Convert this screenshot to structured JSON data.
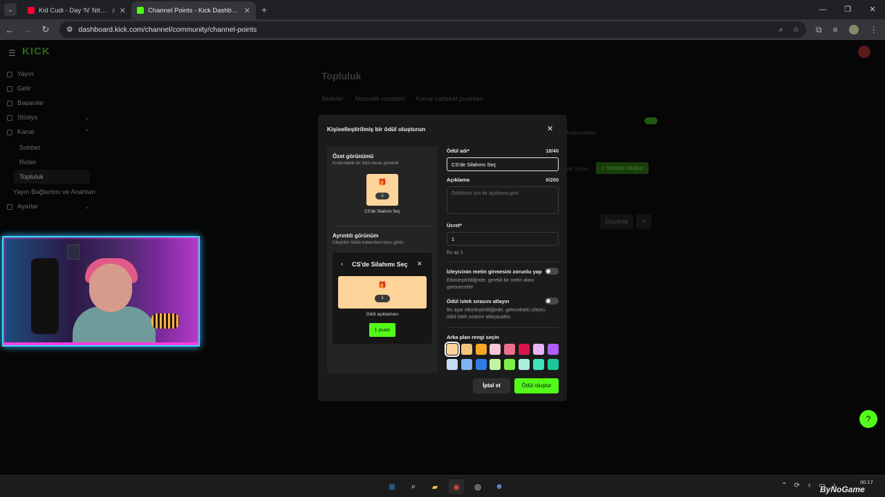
{
  "browser": {
    "tabs": [
      {
        "title": "Kid Cudi - Day 'N' Nite (Lyri",
        "favicon_color": "#ff0033"
      },
      {
        "title": "Channel Points - Kick Dashboar",
        "favicon_color": "#53fc18"
      }
    ],
    "url": "dashboard.kick.com/channel/community/channel-points"
  },
  "sidebar": {
    "logo": "KICK",
    "items": [
      {
        "label": "Yayın"
      },
      {
        "label": "Gelir"
      },
      {
        "label": "Başarılar"
      },
      {
        "label": "Stüdyo"
      },
      {
        "label": "Kanal"
      },
      {
        "label": "Sohbet"
      },
      {
        "label": "Roller"
      },
      {
        "label": "Topluluk"
      },
      {
        "label": "Yayın Bağlantısı ve Anahtarı"
      },
      {
        "label": "Ayarlar"
      }
    ]
  },
  "background_page": {
    "title": "Topluluk",
    "tabs": [
      "İfadeler",
      "Abonelik rozetleri",
      "Kanal sadakat puanları"
    ],
    "text_right": "kullanılabilir.",
    "text_queue": "ak sırası",
    "new_button": "+ Yenisini oluştur",
    "edit_button": "Düzenle"
  },
  "modal": {
    "title": "Kişiselleştirilmiş bir ödül oluşturun",
    "preview": {
      "summary_heading": "Özet görünümü",
      "summary_sub": "Kullanılabilir bir ödül olarak gösterilir",
      "card_count": "1",
      "card_label": "CS'de Silahımı Seç",
      "detail_heading": "Ayrıntılı görünüm",
      "detail_sub": "İzleyiciler ödülü kullanırken bunu görür",
      "detail_title": "CS'de Silahımı Seç",
      "detail_count": "1",
      "detail_desc": "Ödül açıklaması",
      "points_button": "1 puan"
    },
    "form": {
      "name_label": "Ödül adı*",
      "name_count": "18/40",
      "name_value": "CS'de Silahımı Seç",
      "desc_label": "Açıklama",
      "desc_count": "0/200",
      "desc_placeholder": "Ödülünüz için bir açıklama girin",
      "cost_label": "Ücret*",
      "cost_value": "1",
      "cost_note": "En az 1",
      "require_text_label": "İzleyicinin metin girmesini zorunlu yap",
      "require_text_note": "Etkinleştirildiğinde, gerekli bir metin alanı görünecektir",
      "skip_queue_label": "Ödül istek sırasını atlayın",
      "skip_queue_note": "Bu ayar etkinleştirildiğinde, gelecekteki izleyici ödül istek sırasını atlayacaktır.",
      "bg_color_label": "Arka plan rengi seçin",
      "swatches": [
        "#fdd49a",
        "#f5c27a",
        "#f5a623",
        "#f9c5d5",
        "#ec6f8f",
        "#d8164b",
        "#e7b5f5",
        "#b05cf6",
        "#c5dbf7",
        "#7fb2f0",
        "#2f7be5",
        "#c1f5a3",
        "#7bf04a",
        "#a8f0de",
        "#3fe3bd",
        "#19c99a"
      ],
      "selected_swatch": 0,
      "cancel_button": "İptal et",
      "create_button": "Ödül oluştur"
    },
    "accent": "#53fc18"
  },
  "taskbar": {
    "time": "00:17",
    "watermark": "ByNoGame"
  }
}
